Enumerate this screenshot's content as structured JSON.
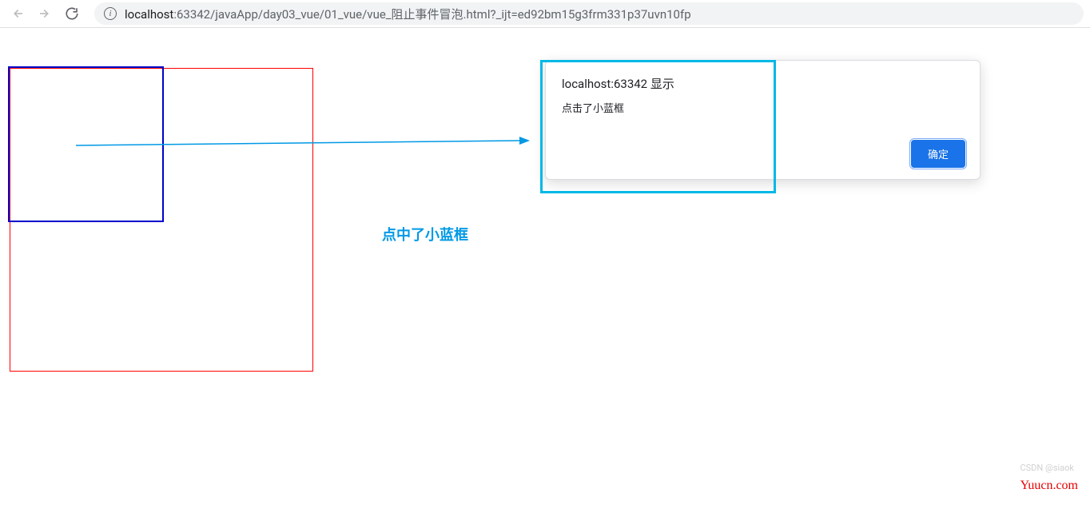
{
  "toolbar": {
    "url_host": "localhost",
    "url_port": ":63342",
    "url_path": "/javaApp/day03_vue/01_vue/vue_阻止事件冒泡.html?_ijt=ed92bm15g3frm331p37uvn10fp"
  },
  "alert": {
    "title": "localhost:63342 显示",
    "message": "点击了小蓝框",
    "ok_label": "确定"
  },
  "annotation": {
    "text": "点中了小蓝框"
  },
  "watermark": {
    "csdn": "CSDN @siaok",
    "yuucn": "Yuucn.com"
  }
}
